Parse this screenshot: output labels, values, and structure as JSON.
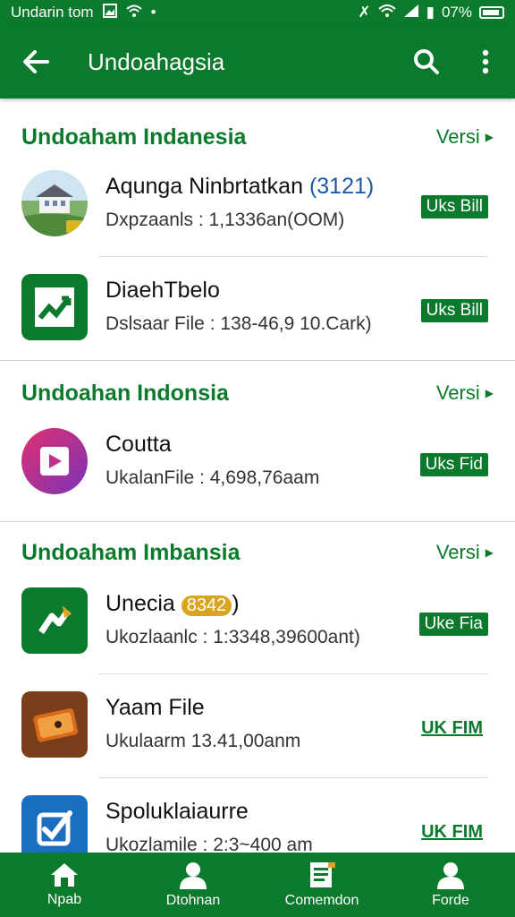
{
  "status_bar": {
    "carrier": "Undarin tom",
    "battery": "07%"
  },
  "app_bar": {
    "title": "Undoahagsia"
  },
  "sections": [
    {
      "title": "Undoaham Indanesia",
      "action": "Versi"
    },
    {
      "title": "Undoahan Indonsia",
      "action": "Versi"
    },
    {
      "title": "Undoaham Imbansia",
      "action": "Versi"
    }
  ],
  "items": [
    {
      "name": "Aqunga Ninbrtatkan",
      "name_suffix": "(3121)",
      "meta": "Dxpzaanls : 1,1336an(OOM)",
      "button": "Uks Bill"
    },
    {
      "name": "DiaehTbelo",
      "meta": "Dslsaar File : 138-46,9 10.Cark)",
      "button": "Uks Bill"
    },
    {
      "name": "Coutta",
      "meta": "UkalanFile : 4,698,76aam",
      "button": "Uks Fid"
    },
    {
      "name": "Unecia",
      "badge": "8342",
      "name_suffix": ")",
      "meta": "Ukozlaanlc : 1:3348,39600ant)",
      "button": "Uke Fia"
    },
    {
      "name": "Yaam File",
      "meta": "Ukulaarm    13.41,00anm",
      "button": "UK FIM"
    },
    {
      "name": "Spoluklaiaurre",
      "meta": "Ukozlamile : 2:3~400 am",
      "button": "UK FIM"
    }
  ],
  "bottom_nav": [
    {
      "label": "Npab",
      "icon": "home-icon"
    },
    {
      "label": "Dtohnan",
      "icon": "person-icon"
    },
    {
      "label": "Comemdon",
      "icon": "document-icon"
    },
    {
      "label": "Forde",
      "icon": "person-icon"
    }
  ],
  "colors": {
    "primary": "#0b7a2c",
    "badge": "#d9a520"
  }
}
